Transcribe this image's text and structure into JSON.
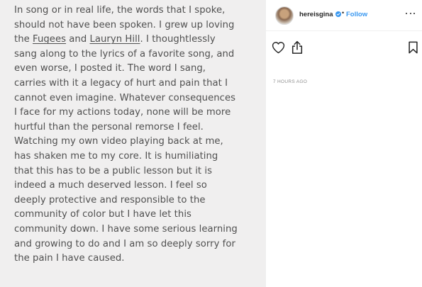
{
  "caption": {
    "lines": [
      "In song or in real life, the words that I spoke,",
      "should not have been spoken. I grew up loving",
      "",
      "sang along to the lyrics of a favorite song, and",
      "even worse, I posted it. The word I sang,",
      "carries with it a legacy of hurt and pain that I",
      "cannot even imagine. Whatever consequences",
      "I face for my actions today, none will be more",
      "hurtful than the personal remorse I feel.",
      "Watching my own video playing back at me,",
      "has shaken me to my core. It is humiliating",
      "that this has to be a public lesson but it is",
      "indeed a much deserved lesson. I feel so",
      "deeply protective and responsible to the",
      "community of color but I have let this",
      "community down. I have some serious learning",
      "and growing to do and I am so deeply sorry for",
      "the pain I have caused."
    ],
    "line3": {
      "pre": "the ",
      "tag1": "Fugees",
      "mid": " and ",
      "tag2": "Lauryn Hill",
      "post": ". I thoughtlessly"
    }
  },
  "header": {
    "username": "hereisgina",
    "separator": "•",
    "follow_label": "Follow"
  },
  "timestamp": "7 HOURS AGO",
  "colors": {
    "follow": "#3897f0",
    "verified": "#3897f0",
    "caption_text": "#505050",
    "image_bg": "#f0efef"
  },
  "icons": [
    "heart-icon",
    "share-icon",
    "bookmark-icon",
    "more-options-icon",
    "verified-badge-icon"
  ]
}
